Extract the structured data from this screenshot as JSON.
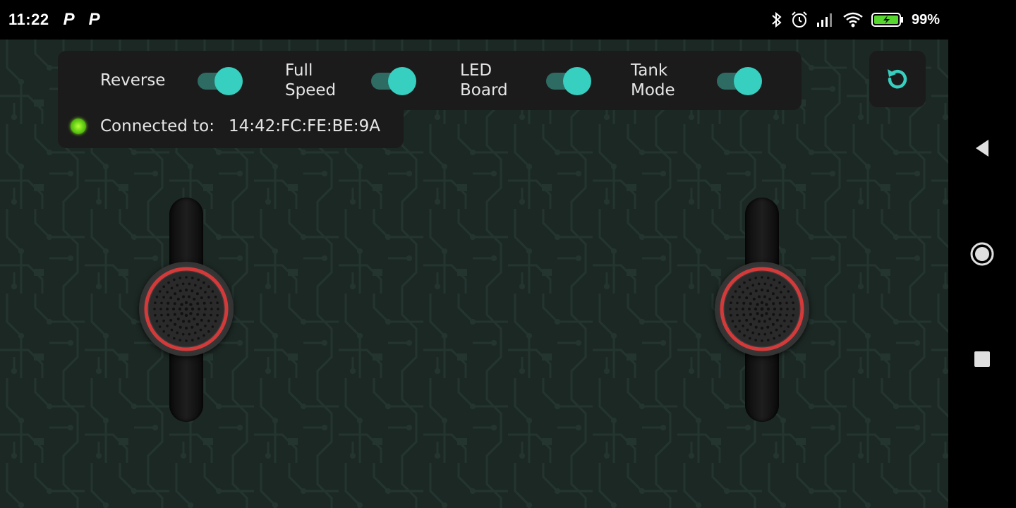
{
  "status_bar": {
    "time": "11:22",
    "notif_icons": [
      "P",
      "P"
    ],
    "battery_text": "99%",
    "icons": [
      "bluetooth-icon",
      "alarm-icon",
      "signal-icon",
      "wifi-icon",
      "battery-icon"
    ]
  },
  "toggles": [
    {
      "label_line1": "Reverse",
      "label_line2": "",
      "on": true
    },
    {
      "label_line1": "Full",
      "label_line2": "Speed",
      "on": true
    },
    {
      "label_line1": "LED",
      "label_line2": "Board",
      "on": true
    },
    {
      "label_line1": "Tank",
      "label_line2": "Mode",
      "on": true
    }
  ],
  "connection": {
    "label": "Connected to:",
    "address": "14:42:FC:FE:BE:9A"
  },
  "colors": {
    "accent": "#36cfc0",
    "background": "#1c2824",
    "panel": "#1b1b1b",
    "knob_ring": "#d43a3a",
    "led": "#6bd416"
  },
  "sliders": [
    {
      "id": "left",
      "level": 0.5
    },
    {
      "id": "right",
      "level": 0.5
    }
  ],
  "nav_bar": [
    "back-icon",
    "home-icon",
    "recents-icon"
  ]
}
